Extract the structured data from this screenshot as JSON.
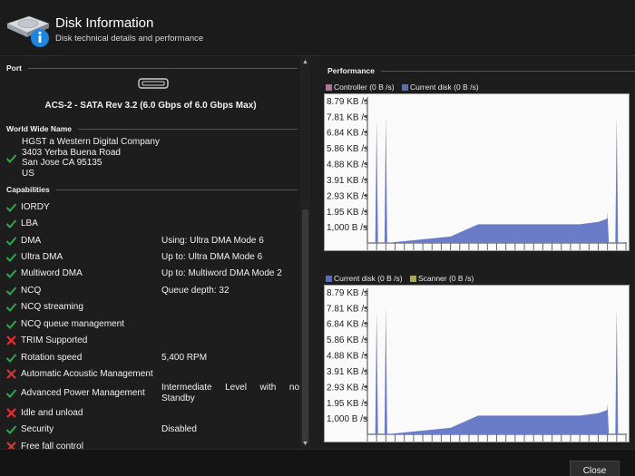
{
  "header": {
    "title": "Disk Information",
    "subtitle": "Disk technical details and performance",
    "icon": "disk-info-icon"
  },
  "port": {
    "heading": "Port",
    "icon": "sata-port-icon",
    "text": "ACS-2 - SATA Rev 3.2 (6.0 Gbps of 6.0 Gbps Max)"
  },
  "wwn": {
    "heading": "World Wide Name",
    "lines": [
      "HGST a Western Digital Company",
      "3403 Yerba Buena Road",
      "San Jose  CA  95135",
      "US"
    ]
  },
  "capabilities": {
    "heading": "Capabilities",
    "items": [
      {
        "label": "IORDY",
        "status": "ok",
        "value": ""
      },
      {
        "label": "LBA",
        "status": "ok",
        "value": ""
      },
      {
        "label": "DMA",
        "status": "ok",
        "value": "Using: Ultra DMA Mode 6"
      },
      {
        "label": "Ultra DMA",
        "status": "ok",
        "value": "Up to: Ultra DMA Mode 6"
      },
      {
        "label": "Multiword DMA",
        "status": "ok",
        "value": "Up to: Multiword DMA Mode 2"
      },
      {
        "label": "NCQ",
        "status": "ok",
        "value": "Queue depth: 32"
      },
      {
        "label": "NCQ streaming",
        "status": "ok",
        "value": ""
      },
      {
        "label": "NCQ queue management",
        "status": "ok",
        "value": ""
      },
      {
        "label": "TRIM Supported",
        "status": "no",
        "value": ""
      },
      {
        "label": "Rotation speed",
        "status": "ok",
        "value": "5,400 RPM"
      },
      {
        "label": "Automatic Acoustic Management",
        "status": "no",
        "value": ""
      },
      {
        "label": "Advanced Power Management",
        "status": "ok",
        "value": "Intermediate Level with no Standby"
      },
      {
        "label": "Idle and unload",
        "status": "no",
        "value": ""
      },
      {
        "label": "Security",
        "status": "ok",
        "value": "Disabled"
      },
      {
        "label": "Free fall control",
        "status": "no",
        "value": ""
      }
    ]
  },
  "performance": {
    "heading": "Performance"
  },
  "colors": {
    "controller": "#b0709a",
    "current_disk": "#5b6bb8",
    "scanner": "#a9a860",
    "fill": "#6a7bc8",
    "ok": "#2ea84a",
    "no": "#e03030"
  },
  "chart_data": [
    {
      "type": "area",
      "legend": [
        "Controller (0 B /s)",
        "Current disk (0 B /s)"
      ],
      "series": [
        {
          "name": "Current disk (0 B /s)"
        }
      ],
      "y_ticks": [
        "8.79 KB /s",
        "7.81 KB /s",
        "6.84 KB /s",
        "5.86 KB /s",
        "4.88 KB /s",
        "3.91 KB /s",
        "2.93 KB /s",
        "1.95 KB /s",
        "1,000 B /s"
      ],
      "y_max": 9000,
      "spikes": [
        {
          "i": 1,
          "v": 7600
        },
        {
          "i": 2,
          "v": 7900
        },
        {
          "i": 26,
          "v": 1900
        },
        {
          "i": 27,
          "v": 7800
        }
      ],
      "area": [
        [
          2,
          0
        ],
        [
          9,
          400
        ],
        [
          12,
          1150
        ],
        [
          23,
          1150
        ],
        [
          25,
          1300
        ],
        [
          26,
          1500
        ]
      ],
      "n_ticks": 28
    },
    {
      "type": "area",
      "legend": [
        "Current disk (0 B /s)",
        "Scanner (0 B /s)"
      ],
      "series": [
        {
          "name": "Current disk (0 B /s)"
        }
      ],
      "y_ticks": [
        "8.79 KB /s",
        "7.81 KB /s",
        "6.84 KB /s",
        "5.86 KB /s",
        "4.88 KB /s",
        "3.91 KB /s",
        "2.93 KB /s",
        "1.95 KB /s",
        "1,000 B /s"
      ],
      "y_max": 9000,
      "spikes": [
        {
          "i": 1,
          "v": 7600
        },
        {
          "i": 2,
          "v": 7900
        },
        {
          "i": 26,
          "v": 1900
        },
        {
          "i": 27,
          "v": 7800
        }
      ],
      "area": [
        [
          2,
          0
        ],
        [
          9,
          400
        ],
        [
          12,
          1150
        ],
        [
          23,
          1150
        ],
        [
          25,
          1300
        ],
        [
          26,
          1500
        ]
      ],
      "n_ticks": 28
    }
  ],
  "footer": {
    "close_label": "Close"
  }
}
